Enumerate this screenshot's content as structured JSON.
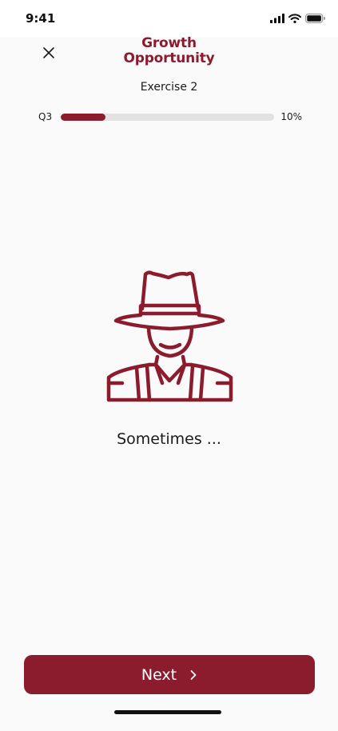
{
  "status_bar": {
    "time": "9:41",
    "icons": [
      "signal-icon",
      "wifi-icon",
      "battery-icon"
    ]
  },
  "header": {
    "close_icon": "close-icon",
    "brand_line1": "Growth",
    "brand_line2": "Opportunity",
    "exercise_title": "Exercise 2"
  },
  "progress": {
    "question_label": "Q3",
    "percent_label": "10%",
    "value_percent": 21
  },
  "content": {
    "illustration_icon": "farmer-with-hat-icon",
    "prompt": "Sometimes ..."
  },
  "footer": {
    "next_label": "Next",
    "next_icon": "chevron-right-icon"
  },
  "colors": {
    "brand": "#8b1c2d",
    "track": "#e2e2e2",
    "text": "#1a1a1a"
  }
}
